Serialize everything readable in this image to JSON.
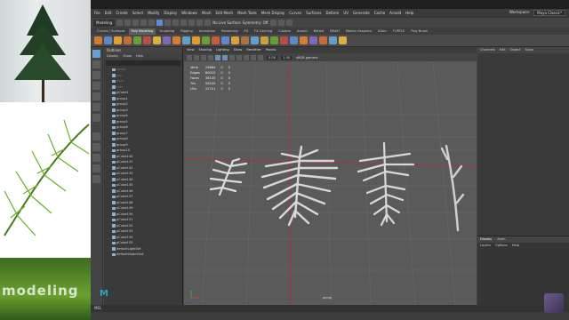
{
  "watermark": "modeling",
  "menubar": {
    "items": [
      "File",
      "Edit",
      "Create",
      "Select",
      "Modify",
      "Display",
      "Windows",
      "Mesh",
      "Edit Mesh",
      "Mesh Tools",
      "Mesh Display",
      "Curves",
      "Surfaces",
      "Deform",
      "UV",
      "Generate",
      "Cache",
      "Arnold",
      "Help"
    ],
    "workspace_label": "Workspace:",
    "workspace_value": "Maya Classic*"
  },
  "statusline": {
    "mode": "Modeling",
    "surface": "No Live Surface",
    "symmetry": "Symmetry: Off"
  },
  "shelf_tabs": [
    "Curves / Surfaces",
    "Poly Modeling",
    "Sculpting",
    "Rigging",
    "Animation",
    "Rendering",
    "FX",
    "FX Caching",
    "Custom",
    "Arnold",
    "Bifrost",
    "MASH",
    "Motion Graphics",
    "XGen",
    "TURTLE",
    "Poly Brush"
  ],
  "shelf_active": "Poly Modeling",
  "outliner": {
    "title": "Outliner",
    "menus": [
      "Display",
      "Show",
      "Help"
    ],
    "items": [
      "persp",
      "top",
      "front",
      "side",
      "pCube1",
      "group1",
      "group2",
      "group3",
      "group4",
      "group5",
      "group6",
      "group7",
      "group8",
      "group9",
      "group10",
      "pCube140",
      "pCube141",
      "pCube142",
      "pCube143",
      "pCube144",
      "pCube145",
      "pCube146",
      "pCube147",
      "pCube148",
      "pCube149",
      "pCube150",
      "pCube151",
      "pCube152",
      "pCube153",
      "pCube154",
      "pCube155",
      "defaultLightSet",
      "defaultObjectSet"
    ]
  },
  "viewport": {
    "menus": [
      "View",
      "Shading",
      "Lighting",
      "Show",
      "Renderer",
      "Panels"
    ],
    "near": "0.00",
    "far": "1.00",
    "colorspace": "sRGB gamma",
    "camera": "persp",
    "hud": [
      {
        "label": "Verts",
        "a": "29684",
        "b": "0",
        "c": "0"
      },
      {
        "label": "Edges",
        "a": "80010",
        "b": "0",
        "c": "0"
      },
      {
        "label": "Faces",
        "a": "38135",
        "b": "0",
        "c": "0"
      },
      {
        "label": "Tris",
        "a": "56240",
        "b": "0",
        "c": "0"
      },
      {
        "label": "UVs",
        "a": "31701",
        "b": "0",
        "c": "0"
      }
    ]
  },
  "channel_box": {
    "menus": [
      "Channels",
      "Edit",
      "Object",
      "Show"
    ],
    "layer_tabs": [
      "Display",
      "Anim"
    ],
    "layer_menus": [
      "Layers",
      "Options",
      "Help"
    ]
  },
  "cmdline": "MEL",
  "logo": "M"
}
